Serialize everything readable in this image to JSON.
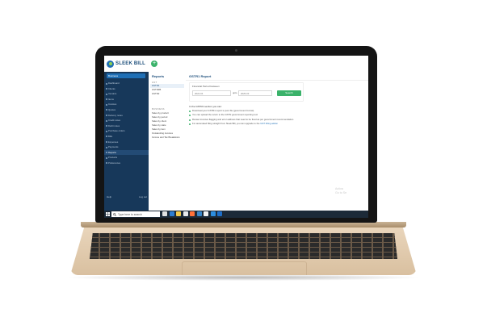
{
  "app": {
    "brand": "SLEEK BILL",
    "add_symbol": "+",
    "business_label": "Business"
  },
  "sidebar": {
    "items": [
      {
        "label": "Dashboard",
        "icon": "dashboard-icon"
      },
      {
        "label": "Clients",
        "icon": "clients-icon"
      },
      {
        "label": "Vendors",
        "icon": "vendors-icon"
      },
      {
        "label": "Items",
        "icon": "items-icon"
      },
      {
        "label": "Invoices",
        "icon": "invoices-icon"
      },
      {
        "label": "Quotes",
        "icon": "quotes-icon"
      },
      {
        "label": "Delivery notes",
        "icon": "delivery-icon"
      },
      {
        "label": "Credit notes",
        "icon": "credit-icon"
      },
      {
        "label": "Debit notes",
        "icon": "debit-icon"
      },
      {
        "label": "Purchase orders",
        "icon": "purchase-icon"
      },
      {
        "label": "Bills",
        "icon": "bills-icon"
      },
      {
        "label": "Expenses",
        "icon": "expenses-icon"
      },
      {
        "label": "Payments",
        "icon": "payments-icon"
      },
      {
        "label": "Reports",
        "icon": "reports-icon",
        "active": true
      },
      {
        "label": "Products",
        "icon": "products-icon"
      },
      {
        "label": "Preferences",
        "icon": "preferences-icon"
      }
    ],
    "footer_left": "Help",
    "footer_right": "Log out"
  },
  "reports_panel": {
    "title": "Reports",
    "gst_section": "GST",
    "gst_items": [
      "GSTR1",
      "GSTR3B",
      "GSTR2"
    ],
    "business_section": "BUSINESS",
    "business_items": [
      "Sales by product",
      "Sales by period",
      "Sales by client",
      "Sales by state",
      "Sales by item",
      "Outstanding invoices",
      "Income and Tax Breakdown"
    ]
  },
  "main": {
    "title": "GSTR1 Report",
    "period_label": "Financial Period between",
    "from_value": "2024-04",
    "upto_label": "upto",
    "to_value": "2025-03",
    "search_label": "Search",
    "intro": "In the GSTR1 section you can:",
    "bullets": [
      {
        "text": "Download your GSTR1 report to json file (government format)",
        "link": ""
      },
      {
        "text": "You can upload the return to the GSTN government reporting tool",
        "link": ""
      },
      {
        "text": "Review invoices flagging and error address that need to be fixed as per government recommendation",
        "link": ""
      },
      {
        "text": "For automated filing straight from Sleek Bill, you can upgrade to the ",
        "link": "GST Filing addon"
      }
    ],
    "watermark_line1": "Activa",
    "watermark_line2": "Go to Se"
  },
  "taskbar": {
    "search_placeholder": "Type here to search",
    "icons": [
      {
        "name": "task-view-icon",
        "color": "#e1e1e1"
      },
      {
        "name": "edge-icon",
        "color": "#2d7dd2"
      },
      {
        "name": "file-explorer-icon",
        "color": "#f2c94c"
      },
      {
        "name": "chrome-icon",
        "color": "#e8eaed"
      },
      {
        "name": "firefox-icon",
        "color": "#ff7139"
      },
      {
        "name": "sleek-bill-icon",
        "color": "#3a87c9"
      },
      {
        "name": "store-icon",
        "color": "#f4f4f4"
      },
      {
        "name": "vscode-icon",
        "color": "#2d8ee0"
      },
      {
        "name": "mail-icon",
        "color": "#1e6ec8"
      }
    ]
  },
  "colors": {
    "sidebar": "#17385a",
    "accent_green": "#3ab26a",
    "brand_blue": "#1f6fb5",
    "laptop_gold": "#e3cdb0"
  }
}
